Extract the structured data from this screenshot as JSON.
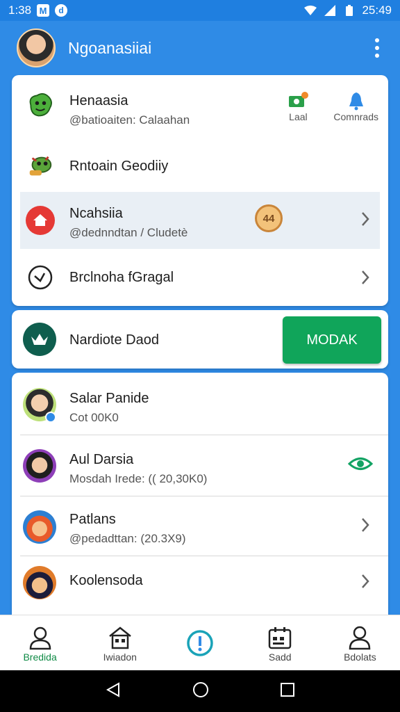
{
  "status_bar": {
    "time": "1:38",
    "right_time": "25:49"
  },
  "app_bar": {
    "title": "Ngoanasiiai"
  },
  "card1": {
    "rows": [
      {
        "title": "Henaasia",
        "subtitle": "@batioaiten: Calaahan"
      },
      {
        "title": "Rntoain Geodiiy"
      },
      {
        "title": "Ncahsiia",
        "subtitle": "@dednndtan / Cludetè",
        "badge": "44"
      },
      {
        "title": "Brclnoha fGragal"
      }
    ],
    "actions": [
      {
        "label": "Laal"
      },
      {
        "label": "Comnrads"
      }
    ]
  },
  "card2": {
    "title": "Nardiote Daod",
    "button_label": "MODAK"
  },
  "contacts": [
    {
      "name": "Salar Panide",
      "detail": "Cot 00K0"
    },
    {
      "name": "Aul Darsia",
      "detail": "Mosdah Irede: (( 20,30K0)"
    },
    {
      "name": "Patlans",
      "detail": "@pedadttan: (20.3X9)"
    },
    {
      "name": "Koolensoda"
    }
  ],
  "bottom_nav": [
    {
      "label": "Bredida"
    },
    {
      "label": "Iwiadon"
    },
    {
      "label": ""
    },
    {
      "label": "Sadd"
    },
    {
      "label": "Bdolats"
    }
  ],
  "colors": {
    "primary": "#2f8be6",
    "accent_green": "#10a55a",
    "active_nav": "#0f8a45"
  }
}
